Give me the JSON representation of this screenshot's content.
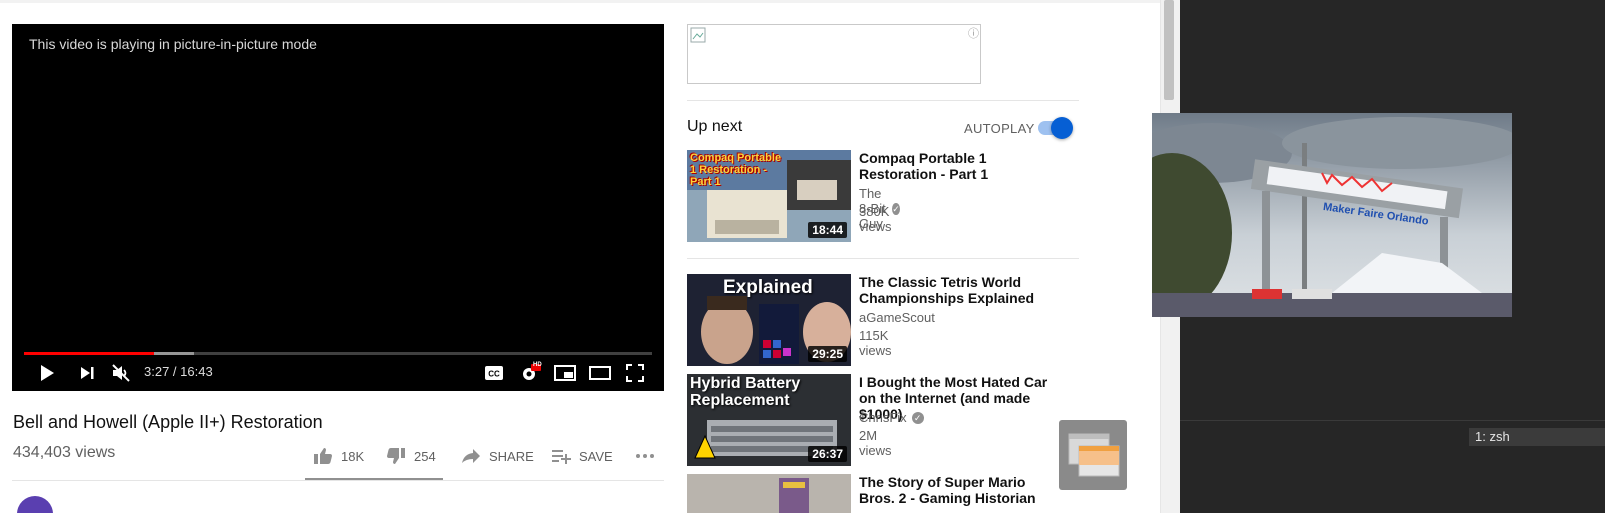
{
  "player": {
    "pip_message": "This video is playing in picture-in-picture mode",
    "time": "3:27 / 16:43",
    "progress_played": 0.207,
    "progress_loaded": 0.27,
    "hd_badge": "HD"
  },
  "video": {
    "title": "Bell and Howell (Apple II+) Restoration",
    "views": "434,403 views",
    "likes": "18K",
    "dislikes": "254",
    "share_label": "SHARE",
    "save_label": "SAVE"
  },
  "ad": {
    "info_icon": "ⓘ"
  },
  "sidebar": {
    "up_next_label": "Up next",
    "autoplay_label": "AUTOPLAY",
    "autoplay_on": true,
    "items": [
      {
        "title": "Compaq Portable 1 Restoration - Part 1",
        "channel": "The 8-Bit Guy",
        "views": "380K views",
        "duration": "18:44",
        "verified": true,
        "thumb_text": "Compaq Portable 1 Restoration - Part 1"
      },
      {
        "title": "The Classic Tetris World Championships Explained",
        "channel": "aGameScout",
        "views": "115K views",
        "duration": "29:25",
        "verified": false,
        "thumb_text": "Explained"
      },
      {
        "title": "I Bought the Most Hated Car on the Internet (and made $1000)",
        "channel": "ChrisFix",
        "views": "2M views",
        "duration": "26:37",
        "verified": true,
        "thumb_text": "Hybrid Battery Replacement"
      },
      {
        "title": "The Story of Super Mario Bros. 2 - Gaming Historian",
        "channel": "",
        "views": "",
        "duration": "",
        "verified": false,
        "thumb_text": ""
      }
    ]
  },
  "terminal": {
    "tab_label": "1: zsh"
  },
  "pip_window": {
    "banner_text": "Maker Faire Orlando"
  },
  "colors": {
    "accent_red": "#ff0000",
    "toggle_blue": "#065fd4",
    "terminal_bg": "#262626"
  }
}
